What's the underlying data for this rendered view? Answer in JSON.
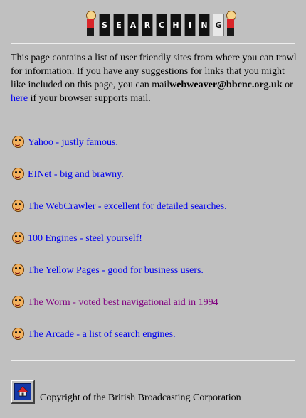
{
  "banner": {
    "letters": [
      "S",
      "E",
      "A",
      "R",
      "C",
      "H",
      "I",
      "N",
      "G"
    ]
  },
  "intro": {
    "text_before_email": "This page contains a list of user friendly sites from where you can trawl for information. If you have any suggestions for links that you might like included on this page, you can mail",
    "email": "webweaver@bbcnc.org.uk",
    "text_or": " or ",
    "here_link": "here ",
    "text_after": "if your browser supports mail."
  },
  "links": [
    {
      "label": "Yahoo - justly famous.",
      "icon": "cartoon-face-icon",
      "visited": false
    },
    {
      "label": "EINet - big and brawny.",
      "icon": "cartoon-face-icon",
      "visited": false
    },
    {
      "label": "The WebCrawler - excellent for detailed searches.",
      "icon": "cartoon-face-icon",
      "visited": false
    },
    {
      "label": "100 Engines - steel yourself!",
      "icon": "cartoon-face-icon",
      "visited": false
    },
    {
      "label": "The Yellow Pages - good for business users.",
      "icon": "cartoon-face-icon",
      "visited": false
    },
    {
      "label": "The Worm - voted best navigational aid in 1994",
      "icon": "cartoon-face-icon",
      "visited": true
    },
    {
      "label": "The Arcade - a list of search engines.",
      "icon": "cartoon-face-icon",
      "visited": false
    }
  ],
  "footer": {
    "home_icon": "home-icon",
    "copyright": "Copyright of the British Broadcasting Corporation"
  },
  "colors": {
    "background": "#c0c0c0",
    "link": "#0000ee",
    "visited_link": "#800080"
  }
}
